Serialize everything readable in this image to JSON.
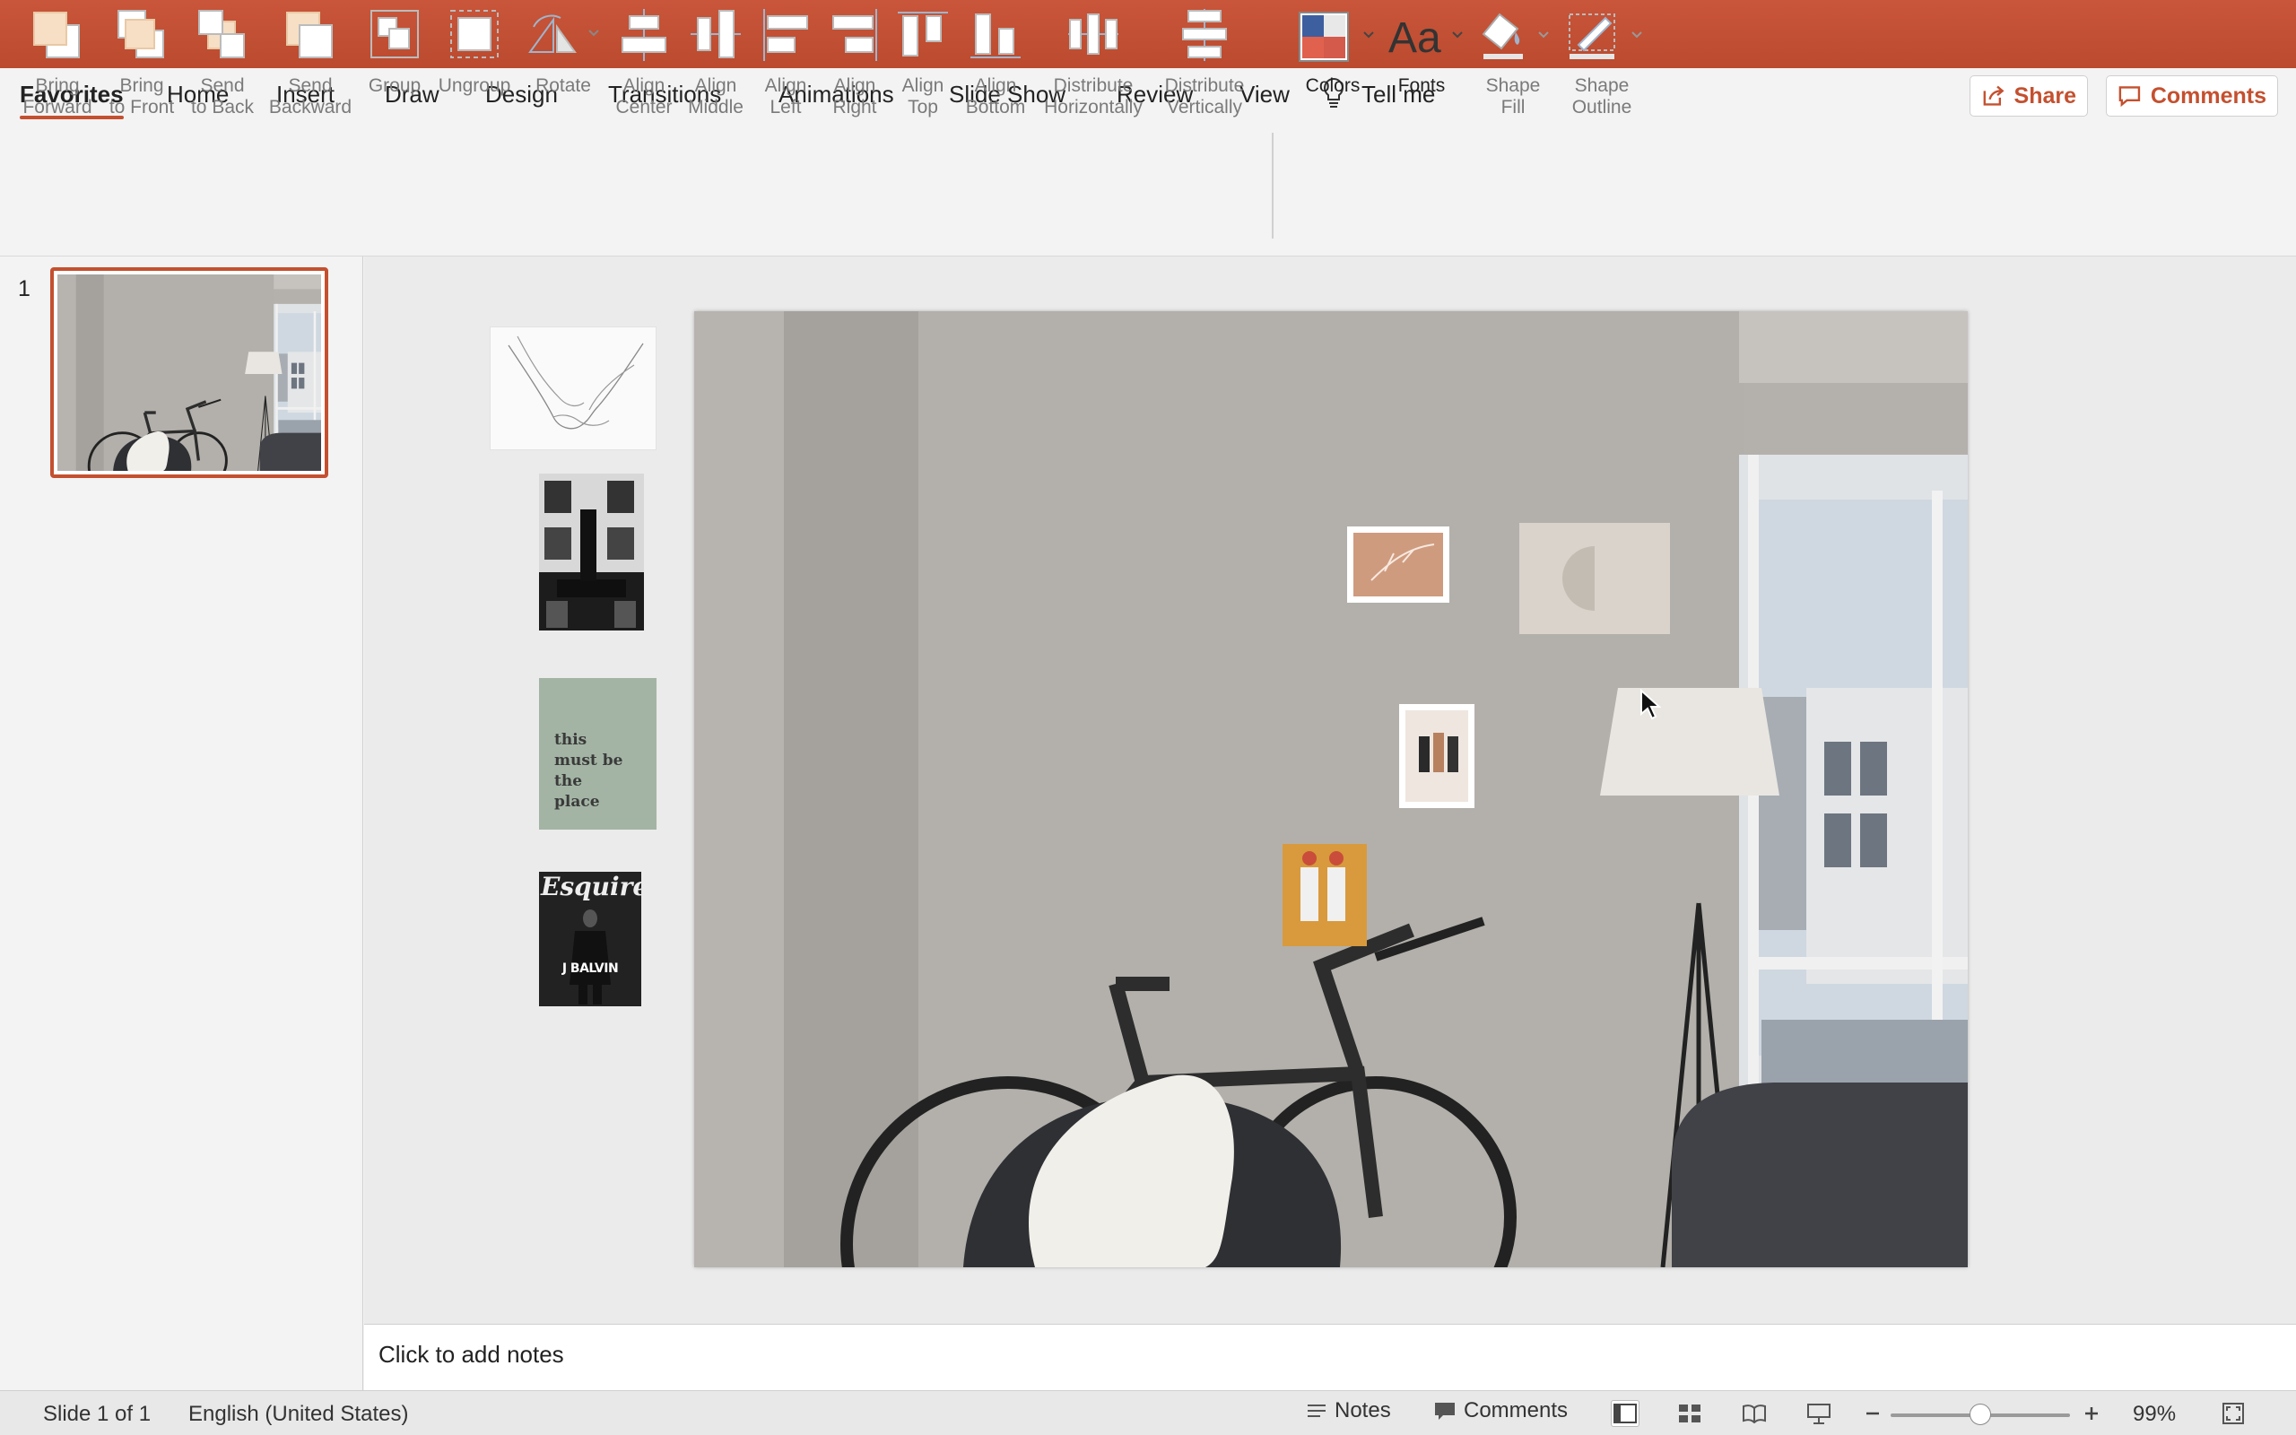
{
  "tabs": [
    {
      "label": "Favorites",
      "active": true
    },
    {
      "label": "Home"
    },
    {
      "label": "Insert"
    },
    {
      "label": "Draw"
    },
    {
      "label": "Design"
    },
    {
      "label": "Transitions"
    },
    {
      "label": "Animations"
    },
    {
      "label": "Slide Show"
    },
    {
      "label": "Review"
    },
    {
      "label": "View"
    },
    {
      "label": "Tell me"
    }
  ],
  "header_buttons": {
    "share": "Share",
    "comments": "Comments"
  },
  "ribbon": [
    {
      "label": "Bring\nForward",
      "icon": "bring-forward-icon"
    },
    {
      "label": "Bring\nto Front",
      "icon": "bring-to-front-icon"
    },
    {
      "label": "Send\nto Back",
      "icon": "send-to-back-icon"
    },
    {
      "label": "Send\nBackward",
      "icon": "send-backward-icon"
    },
    {
      "label": "Group",
      "icon": "group-icon"
    },
    {
      "label": "Ungroup",
      "icon": "ungroup-icon"
    },
    {
      "label": "Rotate",
      "icon": "rotate-icon"
    },
    {
      "label": "Align\nCenter",
      "icon": "align-center-icon"
    },
    {
      "label": "Align\nMiddle",
      "icon": "align-middle-icon"
    },
    {
      "label": "Align\nLeft",
      "icon": "align-left-icon"
    },
    {
      "label": "Align\nRight",
      "icon": "align-right-icon"
    },
    {
      "label": "Align\nTop",
      "icon": "align-top-icon"
    },
    {
      "label": "Align\nBottom",
      "icon": "align-bottom-icon"
    },
    {
      "label": "Distribute\nHorizontally",
      "icon": "distribute-horizontally-icon"
    },
    {
      "label": "Distribute\nVertically",
      "icon": "distribute-vertically-icon"
    },
    {
      "label": "Colors",
      "icon": "colors-icon"
    },
    {
      "label": "Fonts",
      "icon": "fonts-icon"
    },
    {
      "label": "Shape\nFill",
      "icon": "shape-fill-icon"
    },
    {
      "label": "Shape\nOutline",
      "icon": "shape-outline-icon"
    }
  ],
  "thumbnail": {
    "number": "1"
  },
  "side_images": {
    "poster_text": "this\nmust be\nthe\nplace",
    "magazine_title": "Esquire",
    "magazine_cover_name": "J BALVIN"
  },
  "notes_placeholder": "Click to add notes",
  "status": {
    "slide_info": "Slide 1 of 1",
    "language": "English (United States)",
    "notes": "Notes",
    "comments": "Comments",
    "zoom": "99%",
    "zoom_level": 0.5
  },
  "colors": {
    "accent": "#c4502f",
    "titlebar": "#c9563a"
  }
}
